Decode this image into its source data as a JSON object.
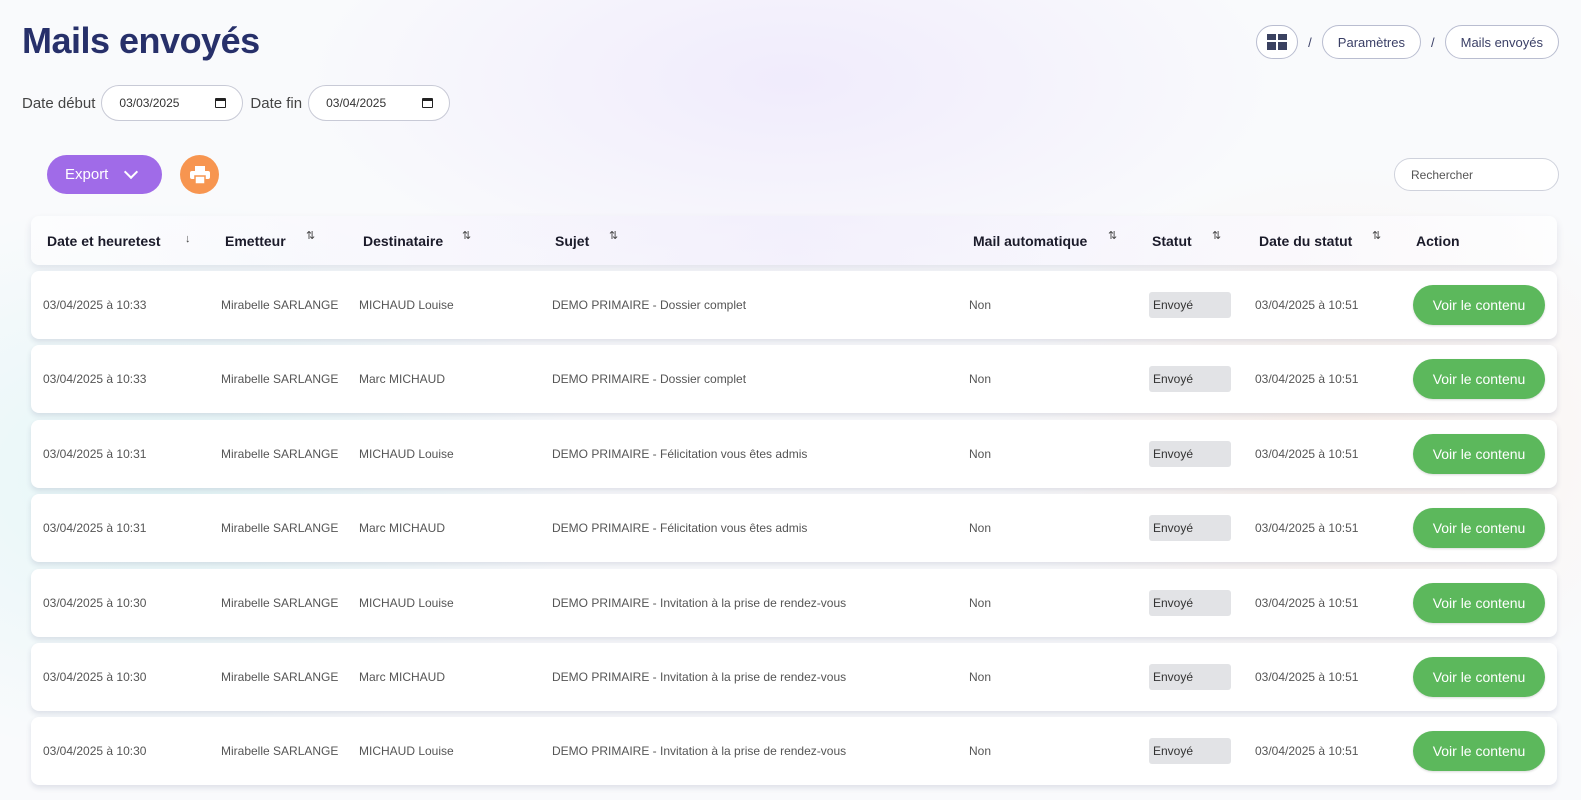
{
  "page": {
    "title": "Mails envoyés"
  },
  "breadcrumb": {
    "items": [
      "Paramètres",
      "Mails envoyés"
    ],
    "separator": "/"
  },
  "filters": {
    "start_label": "Date début",
    "start_value": "03/03/2025",
    "end_label": "Date fin",
    "end_value": "03/04/2025"
  },
  "toolbar": {
    "export_label": "Export",
    "search_placeholder": "Rechercher"
  },
  "table": {
    "columns": [
      "Date et heuretest",
      "Emetteur",
      "Destinataire",
      "Sujet",
      "Mail automatique",
      "Statut",
      "Date du statut",
      "Action"
    ],
    "rows": [
      {
        "date": "03/04/2025 à 10:33",
        "sender": "Mirabelle SARLANGE",
        "recipient": "MICHAUD Louise",
        "subject": "DEMO PRIMAIRE - Dossier complet",
        "auto": "Non",
        "status": "Envoyé",
        "status_date": "03/04/2025 à 10:51",
        "action": "Voir le contenu"
      },
      {
        "date": "03/04/2025 à 10:33",
        "sender": "Mirabelle SARLANGE",
        "recipient": "Marc MICHAUD",
        "subject": "DEMO PRIMAIRE - Dossier complet",
        "auto": "Non",
        "status": "Envoyé",
        "status_date": "03/04/2025 à 10:51",
        "action": "Voir le contenu"
      },
      {
        "date": "03/04/2025 à 10:31",
        "sender": "Mirabelle SARLANGE",
        "recipient": "MICHAUD Louise",
        "subject": "DEMO PRIMAIRE - Félicitation vous êtes admis",
        "auto": "Non",
        "status": "Envoyé",
        "status_date": "03/04/2025 à 10:51",
        "action": "Voir le contenu"
      },
      {
        "date": "03/04/2025 à 10:31",
        "sender": "Mirabelle SARLANGE",
        "recipient": "Marc MICHAUD",
        "subject": "DEMO PRIMAIRE - Félicitation vous êtes admis",
        "auto": "Non",
        "status": "Envoyé",
        "status_date": "03/04/2025 à 10:51",
        "action": "Voir le contenu"
      },
      {
        "date": "03/04/2025 à 10:30",
        "sender": "Mirabelle SARLANGE",
        "recipient": "MICHAUD Louise",
        "subject": "DEMO PRIMAIRE - Invitation à la prise de rendez-vous",
        "auto": "Non",
        "status": "Envoyé",
        "status_date": "03/04/2025 à 10:51",
        "action": "Voir le contenu"
      },
      {
        "date": "03/04/2025 à 10:30",
        "sender": "Mirabelle SARLANGE",
        "recipient": "Marc MICHAUD",
        "subject": "DEMO PRIMAIRE - Invitation à la prise de rendez-vous",
        "auto": "Non",
        "status": "Envoyé",
        "status_date": "03/04/2025 à 10:51",
        "action": "Voir le contenu"
      },
      {
        "date": "03/04/2025 à 10:30",
        "sender": "Mirabelle SARLANGE",
        "recipient": "MICHAUD Louise",
        "subject": "DEMO PRIMAIRE - Invitation à la prise de rendez-vous",
        "auto": "Non",
        "status": "Envoyé",
        "status_date": "03/04/2025 à 10:51",
        "action": "Voir le contenu"
      }
    ]
  },
  "icons": {
    "home": "dashboard-grid-icon",
    "print": "printer-icon",
    "export_toggle": "chevron-down-icon",
    "calendar": "calendar-icon",
    "sort": "sort-arrows-icon"
  },
  "colors": {
    "title": "#27306a",
    "export": "#a06be8",
    "print": "#f79550",
    "action": "#5cb85c",
    "badge": "#e2e3e6"
  }
}
